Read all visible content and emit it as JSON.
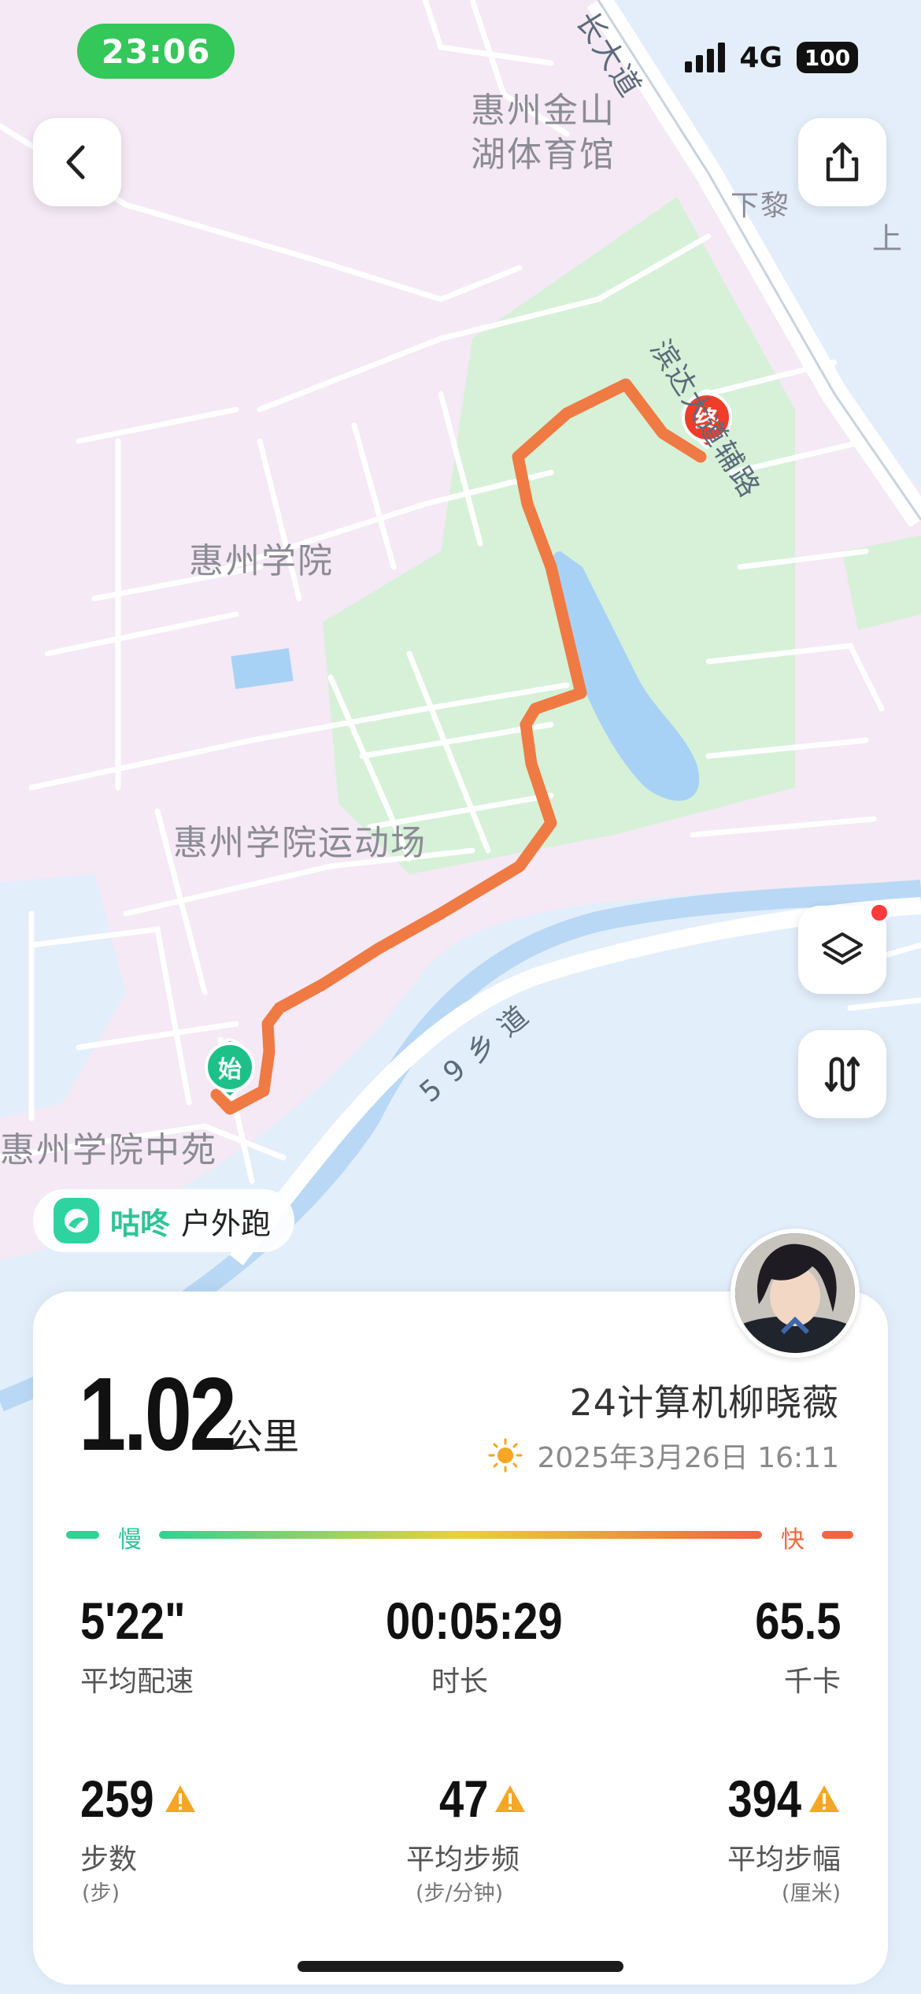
{
  "status_bar": {
    "time": "23:06",
    "network": "4G",
    "battery": "100"
  },
  "map": {
    "labels": {
      "stadium_line1": "惠州金山",
      "stadium_line2": "湖体育馆",
      "xiali": "下黎",
      "shang": "上",
      "road_binda": "滨达大道辅路",
      "road_top": "长大道",
      "college": "惠州学院",
      "sports_field": "惠州学院运动场",
      "road_59": "59乡道",
      "zhongyuan": "惠州学院中苑"
    },
    "start_marker": "始",
    "end_marker": "终",
    "route_color": "#f07a43"
  },
  "brand": {
    "name": "咕咚",
    "activity": "户外跑"
  },
  "summary": {
    "distance": "1.02",
    "distance_unit": "公里",
    "user": "24计算机柳晓薇",
    "datetime": "2025年3月26日 16:11",
    "pace_slow": "慢",
    "pace_fast": "快"
  },
  "stats": {
    "pace": {
      "value": "5'22\"",
      "label": "平均配速"
    },
    "duration": {
      "value": "00:05:29",
      "label": "时长"
    },
    "calories": {
      "value": "65.5",
      "label": "千卡"
    },
    "steps": {
      "value": "259",
      "label": "步数",
      "unit": "(步)"
    },
    "cadence": {
      "value": "47",
      "label": "平均步频",
      "unit": "(步/分钟)"
    },
    "stride": {
      "value": "394",
      "label": "平均步幅",
      "unit": "(厘米)"
    }
  },
  "colors": {
    "accent_green": "#2fc497",
    "warning": "#f5a623",
    "route": "#f07a43"
  }
}
